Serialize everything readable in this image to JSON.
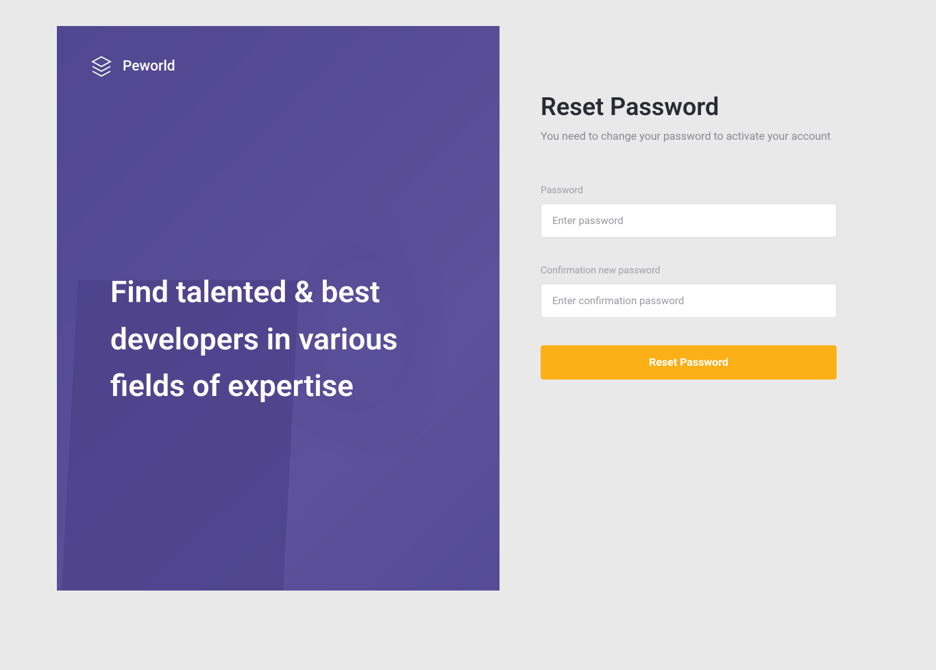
{
  "hero": {
    "brand_name": "Peworld",
    "headline": "Find talented & best developers in various fields of expertise"
  },
  "form": {
    "title": "Reset Password",
    "subtitle": "You need to change your password to activate your account",
    "password_label": "Password",
    "password_placeholder": "Enter password",
    "confirm_label": "Confirmation new password",
    "confirm_placeholder": "Enter confirmation password",
    "submit_label": "Reset Password"
  },
  "colors": {
    "accent_purple": "#5e50a9",
    "accent_orange": "#fbb017"
  }
}
